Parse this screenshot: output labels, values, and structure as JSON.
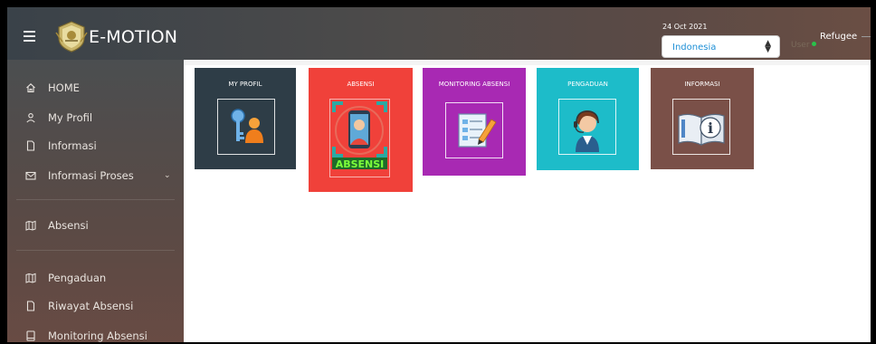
{
  "header": {
    "brand": "E-MOTION",
    "date": "24 Oct 2021",
    "language_select": {
      "value": "Indonesia"
    },
    "user_faint": "User",
    "username": "Refugee"
  },
  "sidebar": {
    "items": [
      {
        "label": "HOME",
        "icon": "home-icon"
      },
      {
        "label": "My Profil",
        "icon": "user-icon"
      },
      {
        "label": "Informasi",
        "icon": "document-icon"
      },
      {
        "label": "Informasi Proses",
        "icon": "mail-icon"
      },
      {
        "label": "Absensi",
        "icon": "map-icon"
      },
      {
        "label": "Pengaduan",
        "icon": "map-icon"
      },
      {
        "label": "Riwayat Absensi",
        "icon": "document-icon"
      },
      {
        "label": "Monitoring Absensi",
        "icon": "tablet-icon"
      }
    ]
  },
  "tiles": [
    {
      "title": "MY PROFIL",
      "color": "#2e3d47",
      "icon": "key-user-icon"
    },
    {
      "title": "ABSENSI",
      "color": "#f0413a",
      "icon": "face-scan-icon",
      "overlay": "ABSENSI"
    },
    {
      "title": "MONITORING ABSENSI",
      "color": "#a829b3",
      "icon": "edit-form-icon"
    },
    {
      "title": "PENGADUAN",
      "color": "#1dbcc9",
      "icon": "support-agent-icon"
    },
    {
      "title": "INFORMASI",
      "color": "#7a5048",
      "icon": "info-book-icon"
    }
  ],
  "colors": {
    "online": "#29c24a",
    "link": "#1d8fd6"
  }
}
